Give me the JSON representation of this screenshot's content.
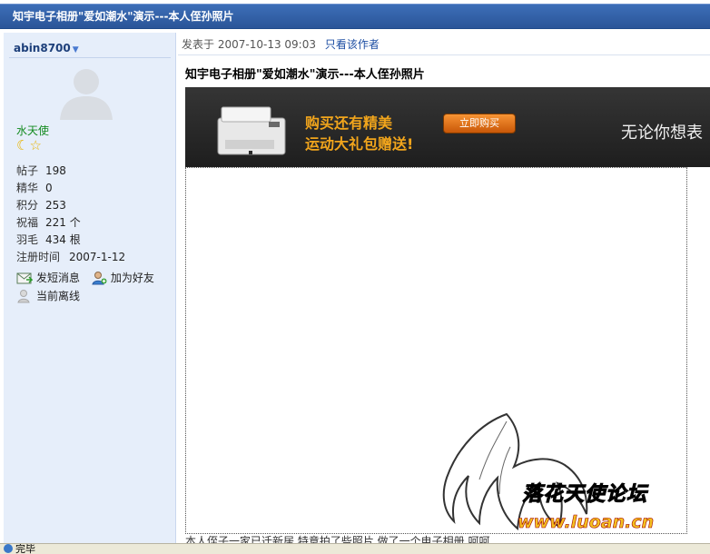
{
  "thread": {
    "title": "知宇电子相册\"爱如潮水\"演示---本人侄孙照片"
  },
  "author": {
    "username": "abin8700",
    "rank_title": "水天使",
    "stats": [
      {
        "label": "帖子",
        "value": "198"
      },
      {
        "label": "精华",
        "value": "0"
      },
      {
        "label": "积分",
        "value": "253"
      },
      {
        "label": "祝福",
        "value": "221 个"
      },
      {
        "label": "羽毛",
        "value": "434 根"
      },
      {
        "label": "注册时间",
        "value": "2007-1-12"
      }
    ],
    "send_message": "发短消息",
    "add_friend": "加为好友",
    "status": "当前离线"
  },
  "post": {
    "posted_at_label": "发表于",
    "posted_at": "2007-10-13 09:03",
    "only_author": "只看该作者",
    "title": "知宇电子相册\"爱如潮水\"演示---本人侄孙照片",
    "text": "本人侄子一家已迁新居,特意拍了些照片,做了一个电子相册,呵呵"
  },
  "banner": {
    "line1": "购买还有精美",
    "line2": "运动大礼包赠送!",
    "button": "立即购买",
    "slogan": "无论你想表"
  },
  "watermark": {
    "name": "落花天使论坛",
    "url": "www.luoan.cn"
  },
  "status_bar": {
    "text": "完毕"
  },
  "colors": {
    "title_bar": "#2f5fa8",
    "sidebar_bg": "#e6eefa",
    "link": "#1d4ea3",
    "rank": "#138a1f",
    "banner_accent": "#f1a51c"
  }
}
